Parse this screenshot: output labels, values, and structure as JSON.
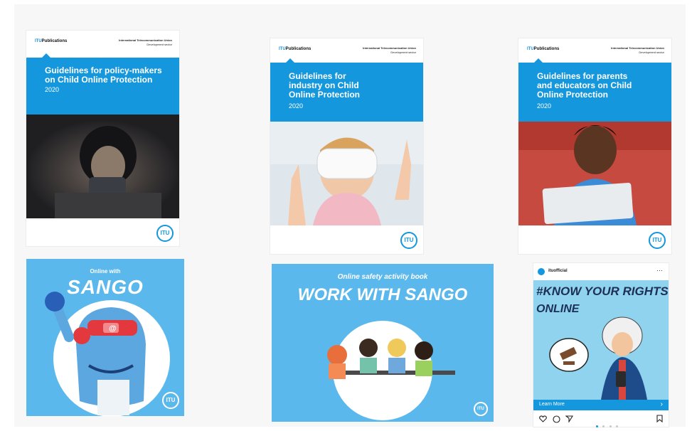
{
  "covers": [
    {
      "publisher_prefix": "ITU",
      "publisher_suffix": "Publications",
      "org_name": "International Telecommunication Union",
      "org_sector": "Development sector",
      "title": "Guidelines for policy-makers on Child Online Protection",
      "year": "2020",
      "logo": "ITU"
    },
    {
      "publisher_prefix": "ITU",
      "publisher_suffix": "Publications",
      "org_name": "International Telecommunication Union",
      "org_sector": "Development sector",
      "title": "Guidelines for industry on Child Online Protection",
      "year": "2020",
      "logo": "ITU"
    },
    {
      "publisher_prefix": "ITU",
      "publisher_suffix": "Publications",
      "org_name": "International Telecommunication Union",
      "org_sector": "Development sector",
      "title": "Guidelines for parents and educators on Child Online Protection",
      "year": "2020",
      "logo": "ITU"
    }
  ],
  "sango_card": {
    "subtitle": "Online with",
    "title": "SANGO",
    "logo": "ITU",
    "badge": "@"
  },
  "activity_card": {
    "subtitle": "Online safety activity book",
    "title": "WORK WITH SANGO",
    "logo": "ITU"
  },
  "instagram": {
    "account": "ituofficial",
    "headline_1": "#KNOW YOUR RIGHTS",
    "headline_2": "ONLINE",
    "cta": "Learn More",
    "menu": "···",
    "logo": "ITU"
  },
  "colors": {
    "itu_blue": "#1497dc",
    "sango_blue": "#5bb8ec",
    "insta_bg": "#8fd3ee"
  }
}
